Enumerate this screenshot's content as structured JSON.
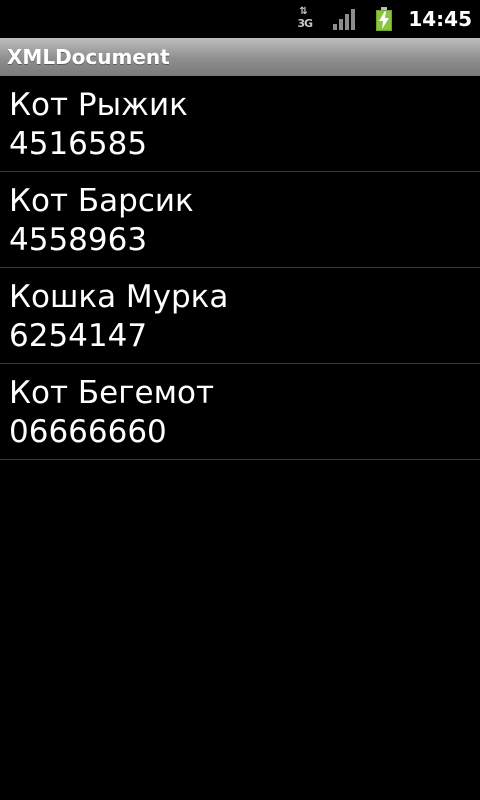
{
  "status_bar": {
    "network_type": "3G",
    "network_icon": "3g-data-icon",
    "signal_icon": "signal-strength-icon",
    "battery_icon": "battery-charging-icon",
    "time": "14:45",
    "colors": {
      "battery": "#8bc53f",
      "text": "#ffffff"
    }
  },
  "title_bar": {
    "title": "XMLDocument"
  },
  "list": {
    "items": [
      {
        "name": "Кот Рыжик",
        "phone": "4516585"
      },
      {
        "name": "Кот Барсик",
        "phone": "4558963"
      },
      {
        "name": "Кошка Мурка",
        "phone": "6254147"
      },
      {
        "name": "Кот Бегемот",
        "phone": "06666660"
      }
    ]
  }
}
